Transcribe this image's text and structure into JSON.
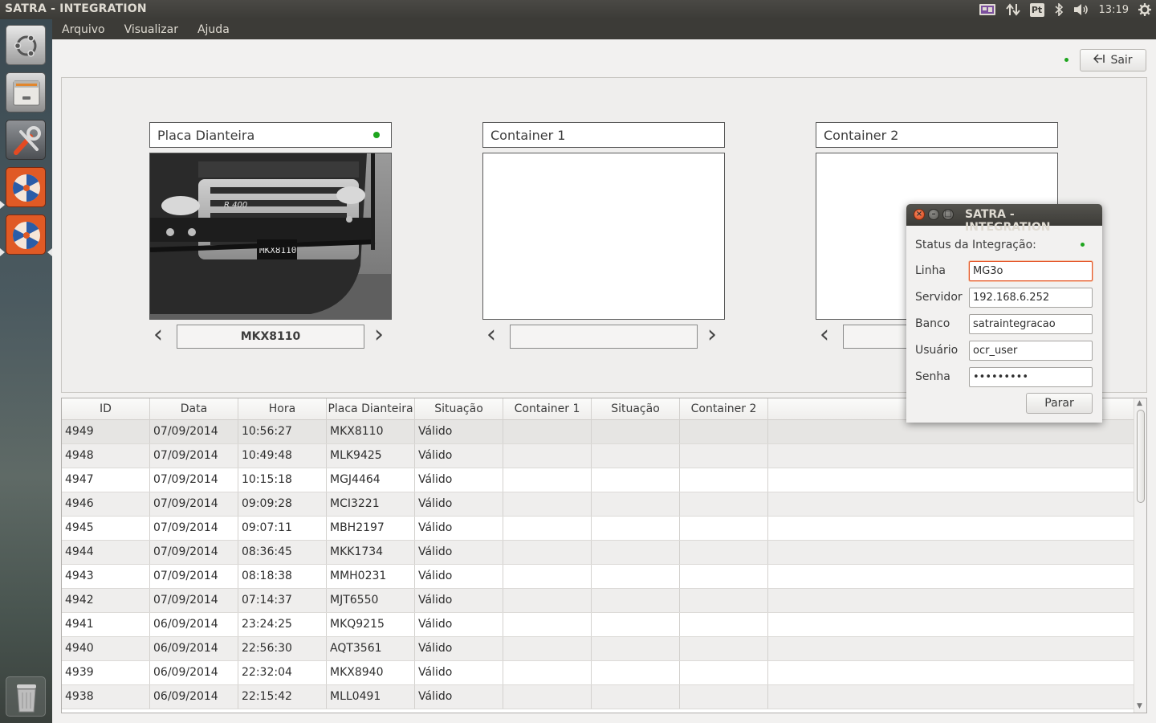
{
  "window": {
    "title": "SATRA - INTEGRATION"
  },
  "panel": {
    "indicators": [
      "display-icon",
      "network-arrows-icon",
      "Pt",
      "bluetooth-icon",
      "volume-icon",
      "gear-icon"
    ],
    "keyboard_layout": "Pt",
    "clock": "13:19"
  },
  "launcher": {
    "items": [
      "ubuntu-dash-icon",
      "files-icon",
      "system-settings-icon",
      "satra-app-icon",
      "satra-app-icon",
      "trash-icon"
    ]
  },
  "menu": {
    "items": [
      "Arquivo",
      "Visualizar",
      "Ajuda"
    ]
  },
  "toolbar": {
    "sair_label": "Sair",
    "status_color": "#1ea51e"
  },
  "cameras": [
    {
      "title": "Placa Dianteira",
      "status": "active",
      "plate": "MKX8110"
    },
    {
      "title": "Container 1",
      "plate": ""
    },
    {
      "title": "Container 2",
      "plate": ""
    }
  ],
  "table": {
    "columns": [
      "ID",
      "Data",
      "Hora",
      "Placa Dianteira",
      "Situação",
      "Container 1",
      "Situação",
      "Container 2"
    ],
    "rows": [
      [
        "4949",
        "07/09/2014",
        "10:56:27",
        "MKX8110",
        "Válido",
        "",
        "",
        ""
      ],
      [
        "4948",
        "07/09/2014",
        "10:49:48",
        "MLK9425",
        "Válido",
        "",
        "",
        ""
      ],
      [
        "4947",
        "07/09/2014",
        "10:15:18",
        "MGJ4464",
        "Válido",
        "",
        "",
        ""
      ],
      [
        "4946",
        "07/09/2014",
        "09:09:28",
        "MCI3221",
        "Válido",
        "",
        "",
        ""
      ],
      [
        "4945",
        "07/09/2014",
        "09:07:11",
        "MBH2197",
        "Válido",
        "",
        "",
        ""
      ],
      [
        "4944",
        "07/09/2014",
        "08:36:45",
        "MKK1734",
        "Válido",
        "",
        "",
        ""
      ],
      [
        "4943",
        "07/09/2014",
        "08:18:38",
        "MMH0231",
        "Válido",
        "",
        "",
        ""
      ],
      [
        "4942",
        "07/09/2014",
        "07:14:37",
        "MJT6550",
        "Válido",
        "",
        "",
        ""
      ],
      [
        "4941",
        "06/09/2014",
        "23:24:25",
        "MKQ9215",
        "Válido",
        "",
        "",
        ""
      ],
      [
        "4940",
        "06/09/2014",
        "22:56:30",
        "AQT3561",
        "Válido",
        "",
        "",
        ""
      ],
      [
        "4939",
        "06/09/2014",
        "22:32:04",
        "MKX8940",
        "Válido",
        "",
        "",
        ""
      ],
      [
        "4938",
        "06/09/2014",
        "22:15:42",
        "MLL0491",
        "Válido",
        "",
        "",
        ""
      ]
    ]
  },
  "dialog": {
    "title": "SATRA - INTEGRATION",
    "status_label": "Status da Integração:",
    "status_color": "#1ea51e",
    "fields": {
      "linha": {
        "label": "Linha",
        "value": "MG3o"
      },
      "servidor": {
        "label": "Servidor",
        "value": "192.168.6.252"
      },
      "banco": {
        "label": "Banco",
        "value": "satraintegracao"
      },
      "usuario": {
        "label": "Usuário",
        "value": "ocr_user"
      },
      "senha": {
        "label": "Senha",
        "value": "•••••••••"
      }
    },
    "parar_label": "Parar"
  }
}
